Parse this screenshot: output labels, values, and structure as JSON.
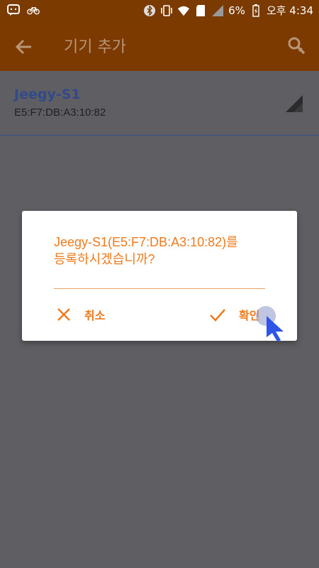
{
  "status_bar": {
    "battery": "6%",
    "time": "오후 4:34"
  },
  "toolbar": {
    "title": "기기 추가",
    "back_icon": "arrow-left-icon",
    "search_icon": "search-icon"
  },
  "device_list": [
    {
      "name": "Jeegy-S1",
      "mac": "E5:F7:DB:A3:10:82",
      "signal_icon": "signal-strength-icon"
    }
  ],
  "dialog": {
    "message_line1": "Jeegy-S1(E5:F7:DB:A3:10:82)를",
    "message_line2": "등록하시겠습니까?",
    "cancel_label": "취소",
    "ok_label": "확인",
    "cancel_icon": "close-icon",
    "ok_icon": "check-icon"
  },
  "colors": {
    "accent": "#f07a1c",
    "toolbar": "#7d3a00",
    "device_name": "#34498a"
  }
}
